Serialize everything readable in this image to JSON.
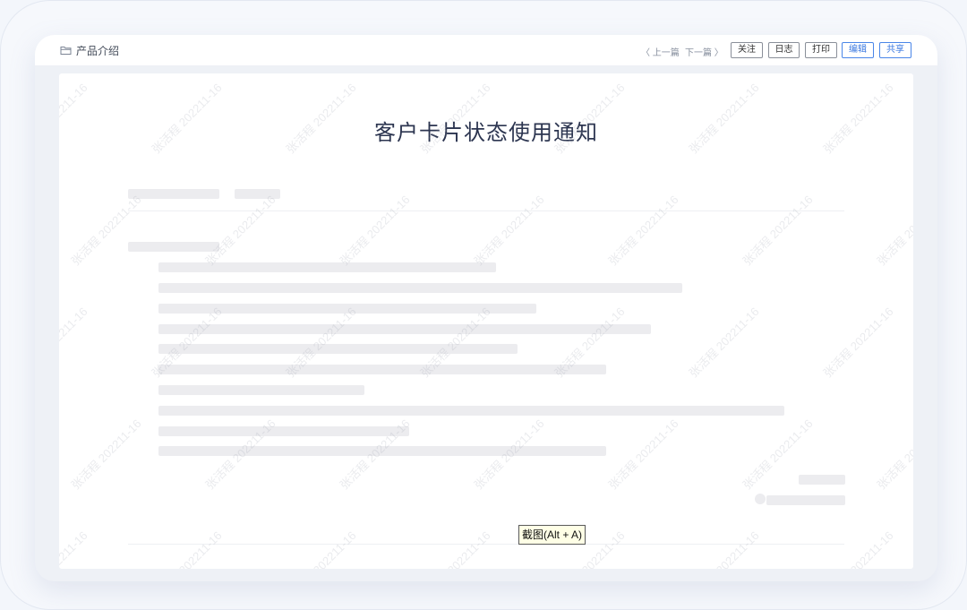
{
  "header": {
    "breadcrumb": "产品介绍",
    "prev_label": "〈 上一篇",
    "next_label": "下一篇 〉",
    "buttons": {
      "follow": "关注",
      "log": "日志",
      "print": "打印",
      "edit": "编辑",
      "share": "共享"
    }
  },
  "document": {
    "title": "客户卡片状态使用通知"
  },
  "watermark": "张活程 202211-16",
  "tooltip": "截图(Alt + A)",
  "colors": {
    "accent": "#3b78e0",
    "title": "#2c3550",
    "placeholder_bar": "#ececef",
    "background": "#eef1f6"
  },
  "icons": {
    "breadcrumb": "folder-icon"
  }
}
